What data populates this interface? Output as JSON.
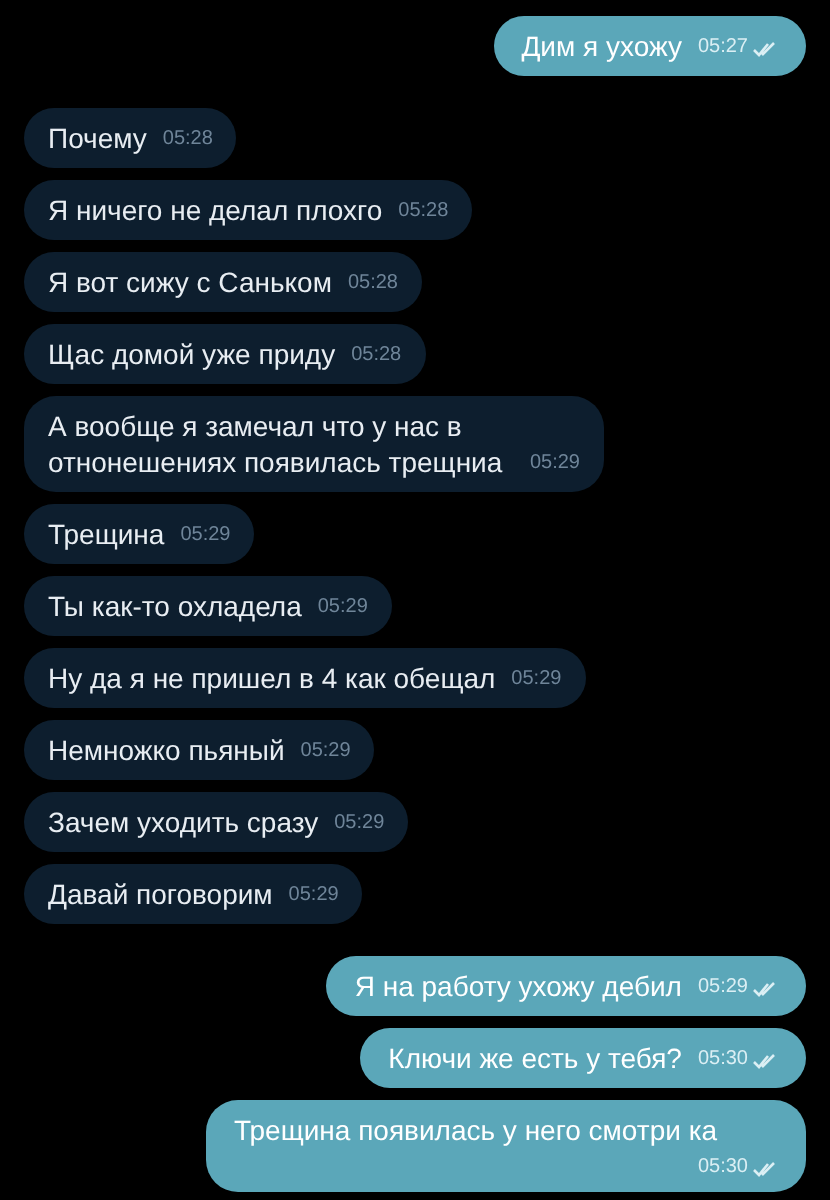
{
  "messages": [
    {
      "kind": "out",
      "text": "Дим я ухожу",
      "time": "05:27",
      "read": true
    },
    {
      "kind": "in",
      "text": "Почему",
      "time": "05:28"
    },
    {
      "kind": "in",
      "text": "Я ничего не делал плохго",
      "time": "05:28"
    },
    {
      "kind": "in",
      "text": "Я вот сижу с Саньком",
      "time": "05:28"
    },
    {
      "kind": "in",
      "text": "Щас домой уже приду",
      "time": "05:28"
    },
    {
      "kind": "in",
      "text": "А вообще я замечал что у нас в отнонешениях появилась трещниа",
      "time": "05:29"
    },
    {
      "kind": "in",
      "text": "Трещина",
      "time": "05:29"
    },
    {
      "kind": "in",
      "text": "Ты как-то охладела",
      "time": "05:29"
    },
    {
      "kind": "in",
      "text": "Ну да я не пришел в 4 как обещал",
      "time": "05:29"
    },
    {
      "kind": "in",
      "text": "Немножко пьяный",
      "time": "05:29"
    },
    {
      "kind": "in",
      "text": "Зачем уходить сразу",
      "time": "05:29"
    },
    {
      "kind": "in",
      "text": "Давай поговорим",
      "time": "05:29"
    },
    {
      "kind": "out",
      "text": "Я на работу ухожу дебил",
      "time": "05:29",
      "read": true
    },
    {
      "kind": "out",
      "text": "Ключи же есть у тебя?",
      "time": "05:30",
      "read": true
    },
    {
      "kind": "out",
      "text": "Трещина появилась у него смотри ка",
      "time": "05:30",
      "read": true
    }
  ]
}
